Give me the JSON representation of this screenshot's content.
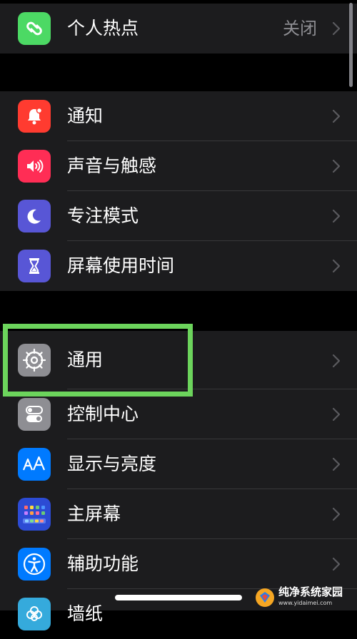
{
  "groups": [
    {
      "items": [
        {
          "label": "个人热点",
          "value": "关闭",
          "icon": "hotspot-icon",
          "color": "#4cd964"
        }
      ]
    },
    {
      "items": [
        {
          "label": "通知",
          "icon": "bell-icon",
          "color": "#ff3b30"
        },
        {
          "label": "声音与触感",
          "icon": "speaker-icon",
          "color": "#ff2d55"
        },
        {
          "label": "专注模式",
          "icon": "moon-icon",
          "color": "#5856d6"
        },
        {
          "label": "屏幕使用时间",
          "icon": "hourglass-icon",
          "color": "#5856d6"
        }
      ]
    },
    {
      "items": [
        {
          "label": "通用",
          "icon": "gear-icon",
          "color": "#8e8e93"
        },
        {
          "label": "控制中心",
          "icon": "toggles-icon",
          "color": "#8e8e93"
        },
        {
          "label": "显示与亮度",
          "icon": "text-size-icon",
          "color": "#007aff"
        },
        {
          "label": "主屏幕",
          "icon": "home-grid-icon",
          "color": "#2c4bd4"
        },
        {
          "label": "辅助功能",
          "icon": "accessibility-icon",
          "color": "#007aff"
        },
        {
          "label": "墙纸",
          "icon": "flower-icon",
          "color": "#35aadc"
        }
      ]
    }
  ],
  "highlighted_item": "通用",
  "highlight_color": "#6cd45c",
  "watermark": {
    "name": "纯净系统家园",
    "url": "www.yidaimei.com"
  }
}
